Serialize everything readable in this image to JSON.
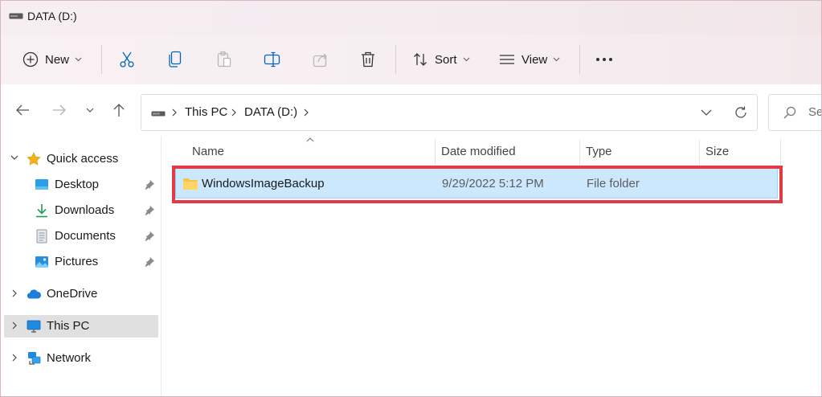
{
  "window": {
    "title": "DATA (D:)"
  },
  "toolbar": {
    "new_label": "New",
    "sort_label": "Sort",
    "view_label": "View"
  },
  "address": {
    "crumbs": [
      "This PC",
      "DATA (D:)"
    ],
    "search_placeholder": "Se"
  },
  "nav": {
    "quick_access": "Quick access",
    "items": [
      {
        "label": "Desktop",
        "icon": "desktop-icon",
        "pinned": true
      },
      {
        "label": "Downloads",
        "icon": "downloads-icon",
        "pinned": true
      },
      {
        "label": "Documents",
        "icon": "documents-icon",
        "pinned": true
      },
      {
        "label": "Pictures",
        "icon": "pictures-icon",
        "pinned": true
      }
    ],
    "onedrive": "OneDrive",
    "this_pc": "This PC",
    "network": "Network"
  },
  "columns": {
    "name": "Name",
    "date": "Date modified",
    "type": "Type",
    "size": "Size"
  },
  "files": [
    {
      "name": "WindowsImageBackup",
      "date": "9/29/2022 5:12 PM",
      "type": "File folder",
      "size": "",
      "selected": true
    }
  ],
  "colors": {
    "selection": "#cce8ff",
    "highlight": "#e23b46",
    "folder": "#f5c44e",
    "accent": "#0067c0"
  }
}
